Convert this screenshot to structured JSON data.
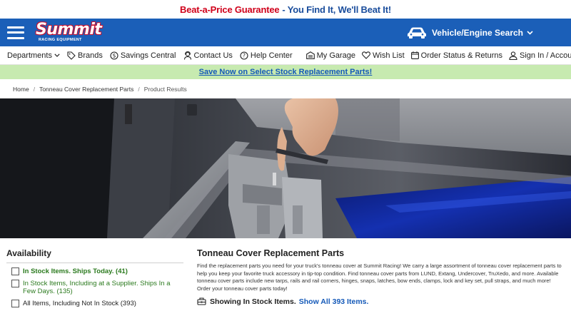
{
  "promo_top": {
    "part1": "Beat-a-Price Guarantee",
    "part2": " - You Find It, We'll Beat It!"
  },
  "header": {
    "logo_text": "Summit",
    "logo_sub": "RACING EQUIPMENT",
    "vehicle_search": "Vehicle/Engine Search",
    "colors": {
      "brand_blue": "#1b5fb8",
      "logo_red": "#c8102e"
    }
  },
  "nav": {
    "left": [
      {
        "label": "Departments",
        "icon": ""
      },
      {
        "label": "Brands",
        "icon": "tag-icon"
      },
      {
        "label": "Savings Central",
        "icon": "dollar-icon"
      },
      {
        "label": "Contact Us",
        "icon": "headset-icon"
      },
      {
        "label": "Help Center",
        "icon": "help-icon"
      }
    ],
    "right": [
      {
        "label": "My Garage",
        "icon": "garage-icon"
      },
      {
        "label": "Wish List",
        "icon": "heart-icon"
      },
      {
        "label": "Order Status & Returns",
        "icon": "calendar-icon"
      },
      {
        "label": "Sign In / Account",
        "icon": "user-icon"
      }
    ]
  },
  "promo_green": "Save Now on Select Stock Replacement Parts!",
  "breadcrumb": {
    "items": [
      "Home",
      "Tonneau Cover Replacement Parts"
    ],
    "current": "Product Results"
  },
  "sidebar": {
    "title": "Availability",
    "options": [
      {
        "label": "In Stock Items. Ships Today. (41)",
        "style": "green-bold"
      },
      {
        "label": "In Stock Items, Including at a Supplier. Ships In a Few Days. (135)",
        "style": "green"
      },
      {
        "label": "All Items, Including Not In Stock (393)",
        "style": "dark"
      }
    ]
  },
  "main": {
    "title": "Tonneau Cover Replacement Parts",
    "description": "Find the replacement parts you need for your truck's tonneau cover at Summit Racing! We carry a large assortment of tonneau cover replacement parts to help you keep your favorite truck accessory in tip-top condition. Find tonneau cover parts from LUND, Extang, Undercover, TruXedo, and more. Available tonneau cover parts include new tarps, rails and rail corners, hinges, snaps, latches, bow ends, clamps, lock and key set, pull straps, and much more! Order your tonneau cover parts today!",
    "showing": "Showing In Stock Items.",
    "show_all": "Show All 393 Items."
  }
}
